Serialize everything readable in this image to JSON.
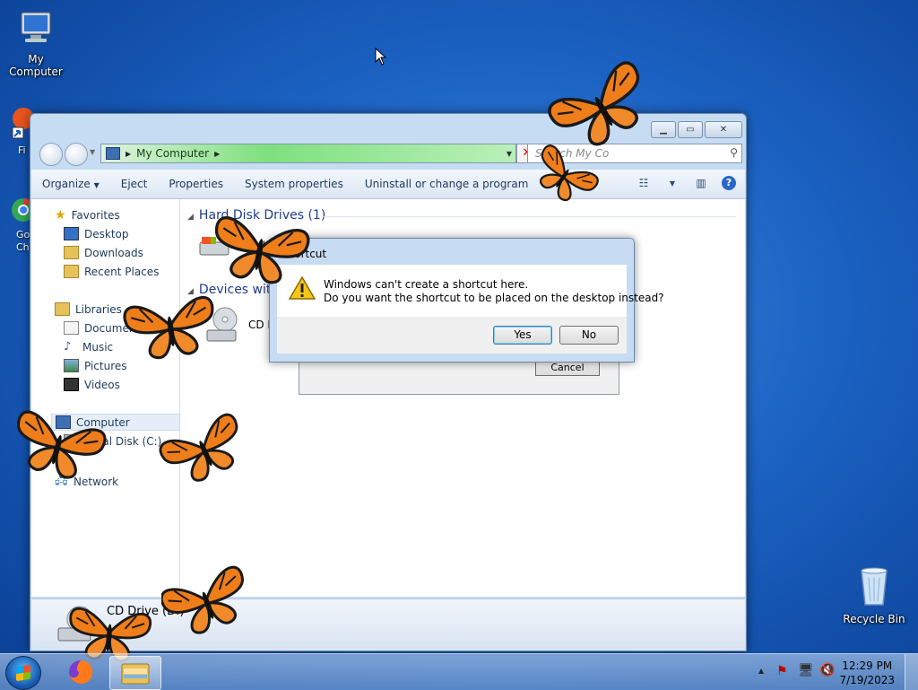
{
  "desktop": {
    "icons": [
      {
        "label": "My Computer"
      },
      {
        "label": "Recycle Bin"
      }
    ],
    "partial_icons": [
      {
        "label": "Fi"
      },
      {
        "label": "Go\nCh"
      }
    ]
  },
  "explorer": {
    "address": {
      "crumb": "My Computer"
    },
    "search_placeholder": "Search My Co",
    "toolbar": [
      "Organize",
      "Eject",
      "Properties",
      "System properties",
      "Uninstall or change a program",
      "»"
    ],
    "nav": {
      "favorites": "Favorites",
      "favorites_items": [
        "Desktop",
        "Downloads",
        "Recent Places"
      ],
      "libraries": "Libraries",
      "libraries_items": [
        "Documents",
        "Music",
        "Pictures",
        "Videos"
      ],
      "computer": "Computer",
      "computer_items": [
        "Local Disk (C:)"
      ],
      "network": "Network"
    },
    "groups": {
      "hdd": "Hard Disk Drives (1)",
      "hdd_item": "Local D",
      "removable": "Devices with",
      "removable_item": "CD D"
    },
    "details_label": "CD Drive (D:)"
  },
  "back_dialog": {
    "cancel": "Cancel"
  },
  "dialog": {
    "title": "Shortcut",
    "line1": "Windows can't create a shortcut here.",
    "line2": "Do you want the shortcut to be placed on the desktop instead?",
    "yes": "Yes",
    "no": "No"
  },
  "taskbar": {
    "time": "12:29 PM",
    "date": "7/19/2023",
    "tray_arrow": "▲"
  }
}
